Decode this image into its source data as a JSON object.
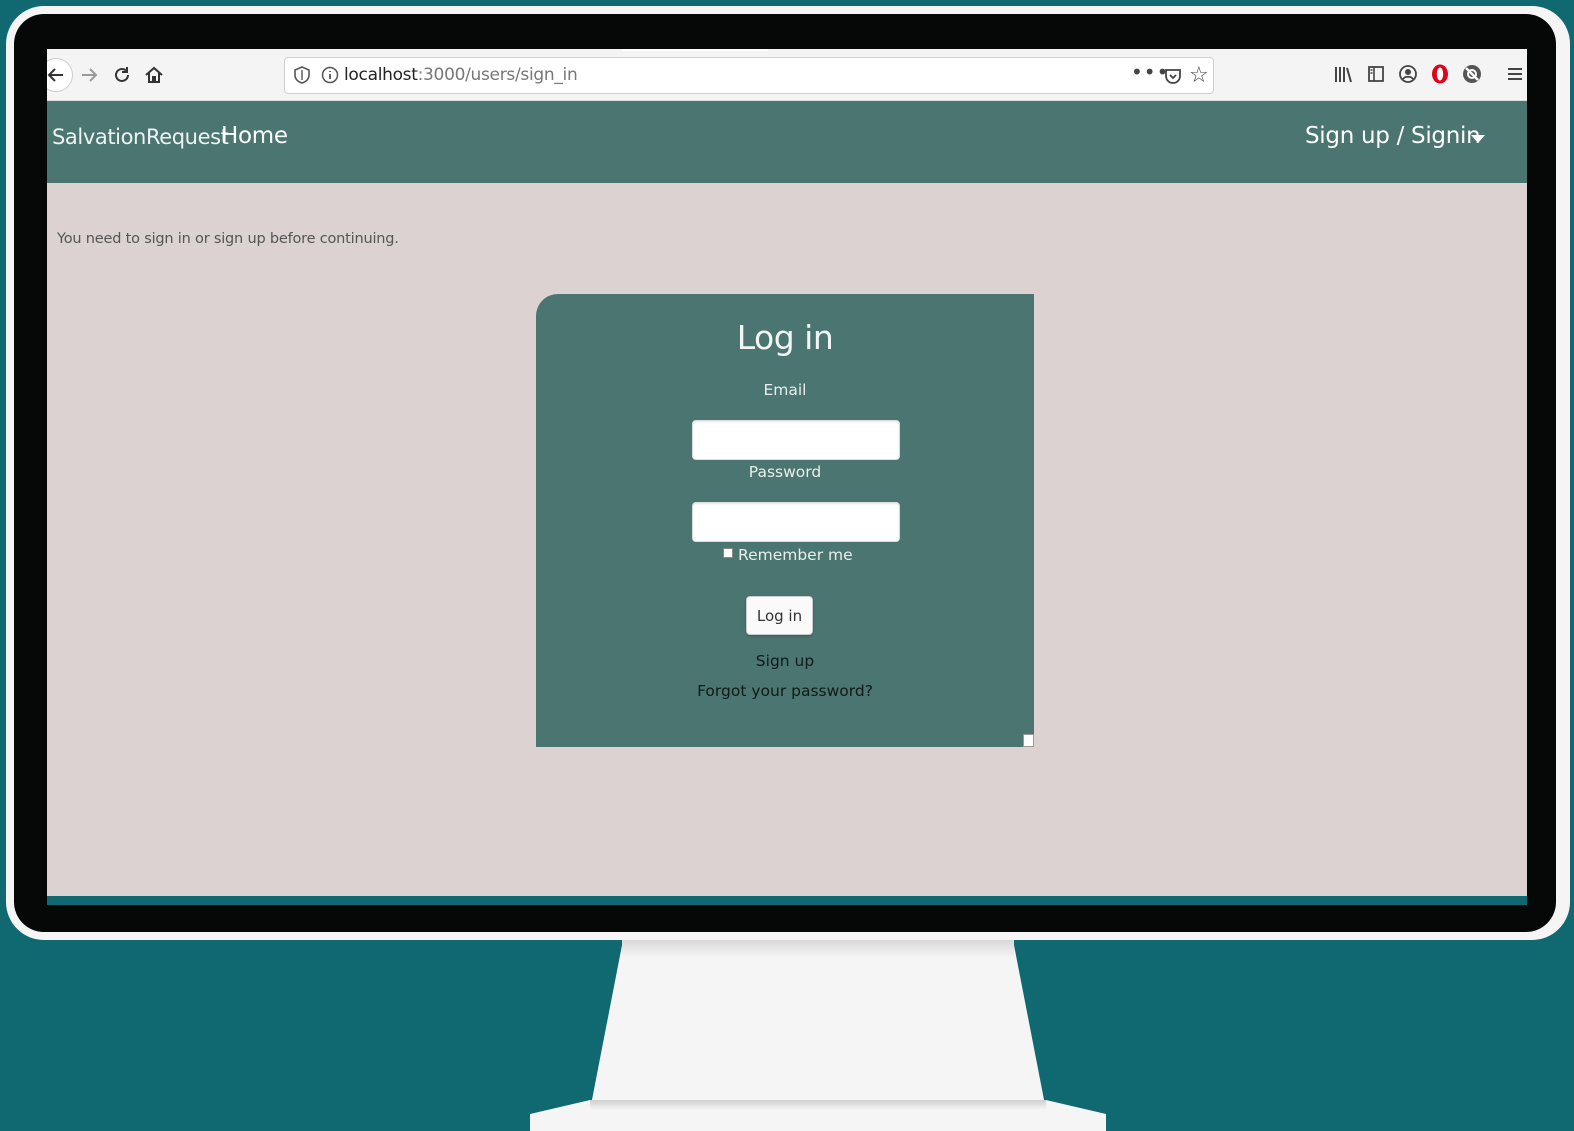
{
  "browser": {
    "url_host": "localhost",
    "url_path": ":3000/users/sign_in",
    "more_label": "•••"
  },
  "app": {
    "brand": "SalvationRequest",
    "nav_home": "Home",
    "nav_account": "Sign up / Signin"
  },
  "flash": "You need to sign in or sign up before continuing.",
  "login": {
    "title": "Log in",
    "email_label": "Email",
    "email_value": "",
    "password_label": "Password",
    "password_value": "",
    "remember_label": "Remember me",
    "remember_checked": false,
    "submit_label": "Log in",
    "signup_link": "Sign up",
    "forgot_link": "Forgot your password?"
  },
  "colors": {
    "background": "#106871",
    "navbar": "#4b7571",
    "page": "#dbd2d1",
    "panel": "#4b7571",
    "monitor_frame": "#f5f5f5",
    "bezel": "#060808"
  }
}
